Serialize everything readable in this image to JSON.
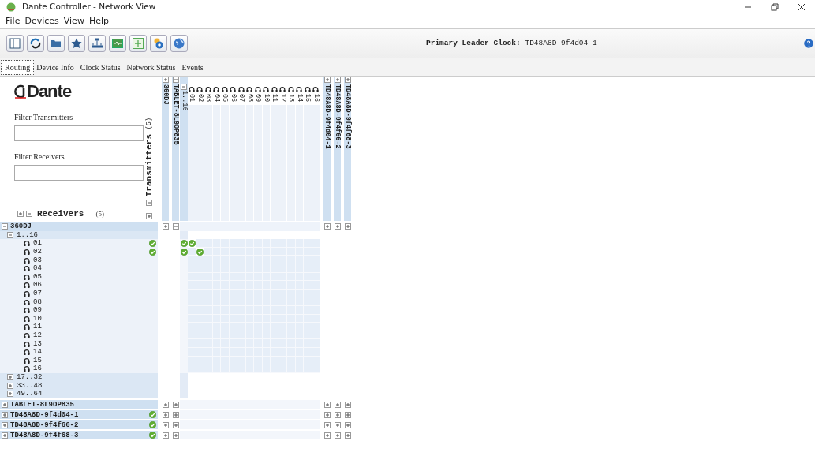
{
  "window": {
    "title": "Dante Controller - Network View"
  },
  "menu": [
    "File",
    "Devices",
    "View",
    "Help"
  ],
  "leader_clock": {
    "label": "Primary Leader Clock:",
    "value": "TD48A8D-9f4d04-1"
  },
  "tabs": [
    {
      "label": "Routing",
      "selected": true
    },
    {
      "label": "Device Info",
      "selected": false
    },
    {
      "label": "Clock Status",
      "selected": false
    },
    {
      "label": "Network Status",
      "selected": false
    },
    {
      "label": "Events",
      "selected": false
    }
  ],
  "logo": "Dante",
  "filters": [
    {
      "label": "Filter Transmitters"
    },
    {
      "label": "Filter Receivers"
    }
  ],
  "transmitters": {
    "label": "Transmitters",
    "count": "(5)"
  },
  "receivers": {
    "label": "Receivers",
    "count": "(5)"
  },
  "tx_devices": [
    {
      "name": "360DJ",
      "expanded": false
    },
    {
      "name": "TABLET-8L9OP835",
      "expanded": true,
      "groups": [
        {
          "label": "1..16",
          "expanded": true,
          "channels": [
            "01",
            "02",
            "03",
            "04",
            "05",
            "06",
            "07",
            "08",
            "09",
            "10",
            "11",
            "12",
            "13",
            "14",
            "15",
            "16"
          ]
        }
      ]
    },
    {
      "name": "TD48A8D-9f4d04-1",
      "expanded": false
    },
    {
      "name": "TD48A8D-9f4f66-2",
      "expanded": false
    },
    {
      "name": "TD48A8D-9f4f68-3",
      "expanded": false
    }
  ],
  "rx_devices": [
    {
      "name": "360DJ",
      "expanded": true,
      "status_ok": false,
      "groups": [
        {
          "label": "1..16",
          "expanded": true,
          "channels": [
            {
              "name": "01",
              "subscribed": true
            },
            {
              "name": "02",
              "subscribed": true
            },
            {
              "name": "03",
              "subscribed": false
            },
            {
              "name": "04",
              "subscribed": false
            },
            {
              "name": "05",
              "subscribed": false
            },
            {
              "name": "06",
              "subscribed": false
            },
            {
              "name": "07",
              "subscribed": false
            },
            {
              "name": "08",
              "subscribed": false
            },
            {
              "name": "09",
              "subscribed": false
            },
            {
              "name": "10",
              "subscribed": false
            },
            {
              "name": "11",
              "subscribed": false
            },
            {
              "name": "12",
              "subscribed": false
            },
            {
              "name": "13",
              "subscribed": false
            },
            {
              "name": "14",
              "subscribed": false
            },
            {
              "name": "15",
              "subscribed": false
            },
            {
              "name": "16",
              "subscribed": false
            }
          ]
        },
        {
          "label": "17..32",
          "expanded": false
        },
        {
          "label": "33..48",
          "expanded": false
        },
        {
          "label": "49..64",
          "expanded": false
        }
      ]
    },
    {
      "name": "TABLET-8L9OP835",
      "expanded": false,
      "status_ok": false
    },
    {
      "name": "TD48A8D-9f4d04-1",
      "expanded": false,
      "status_ok": true
    },
    {
      "name": "TD48A8D-9f4f66-2",
      "expanded": false,
      "status_ok": true
    },
    {
      "name": "TD48A8D-9f4f68-3",
      "expanded": false,
      "status_ok": true
    }
  ]
}
